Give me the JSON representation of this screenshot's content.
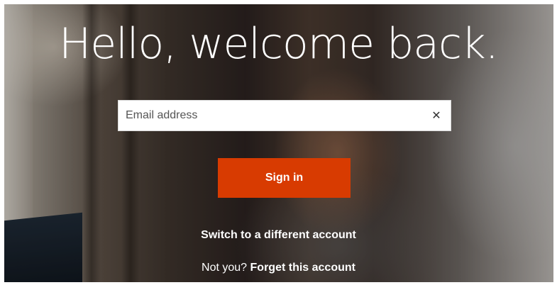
{
  "headline": "Hello, welcome back.",
  "email": {
    "placeholder": "Email address",
    "value": "",
    "clear_icon": "close-icon",
    "clear_glyph": "✕"
  },
  "signin": {
    "label": "Sign in",
    "color": "#d83b01"
  },
  "switch_account": {
    "label": "Switch to a different account"
  },
  "forget": {
    "prefix": "Not you?",
    "link_label": "Forget this account"
  }
}
